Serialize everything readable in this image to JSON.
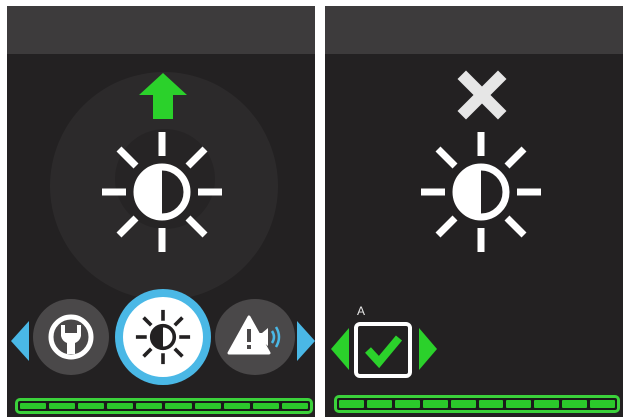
{
  "colors": {
    "panel_bg": "#232122",
    "title_bar": "#3d3b3c",
    "accent_green": "#2bd12b",
    "accent_blue": "#4ab8e6",
    "icon_white": "#ffffff",
    "wheel_bg": "#2c2a2b"
  },
  "left_screen": {
    "up_arrow_icon": "arrow-up-icon",
    "main_icon": "brightness-icon",
    "carousel": {
      "items": [
        {
          "icon": "wrench-icon",
          "selected": false
        },
        {
          "icon": "brightness-icon",
          "selected": true
        },
        {
          "icon": "warning-volume-icon",
          "selected": false
        }
      ],
      "left_arrow": "chevron-left-icon",
      "right_arrow": "chevron-right-icon"
    },
    "progress": {
      "segments": 10,
      "filled": 10
    }
  },
  "right_screen": {
    "close_icon": "close-icon",
    "main_icon": "brightness-icon",
    "confirm": {
      "hint_label": "A",
      "icon": "checkbox-checked-icon",
      "left_arrow": "chevron-left-icon",
      "right_arrow": "chevron-right-icon"
    },
    "progress": {
      "segments": 10,
      "filled": 10
    }
  }
}
